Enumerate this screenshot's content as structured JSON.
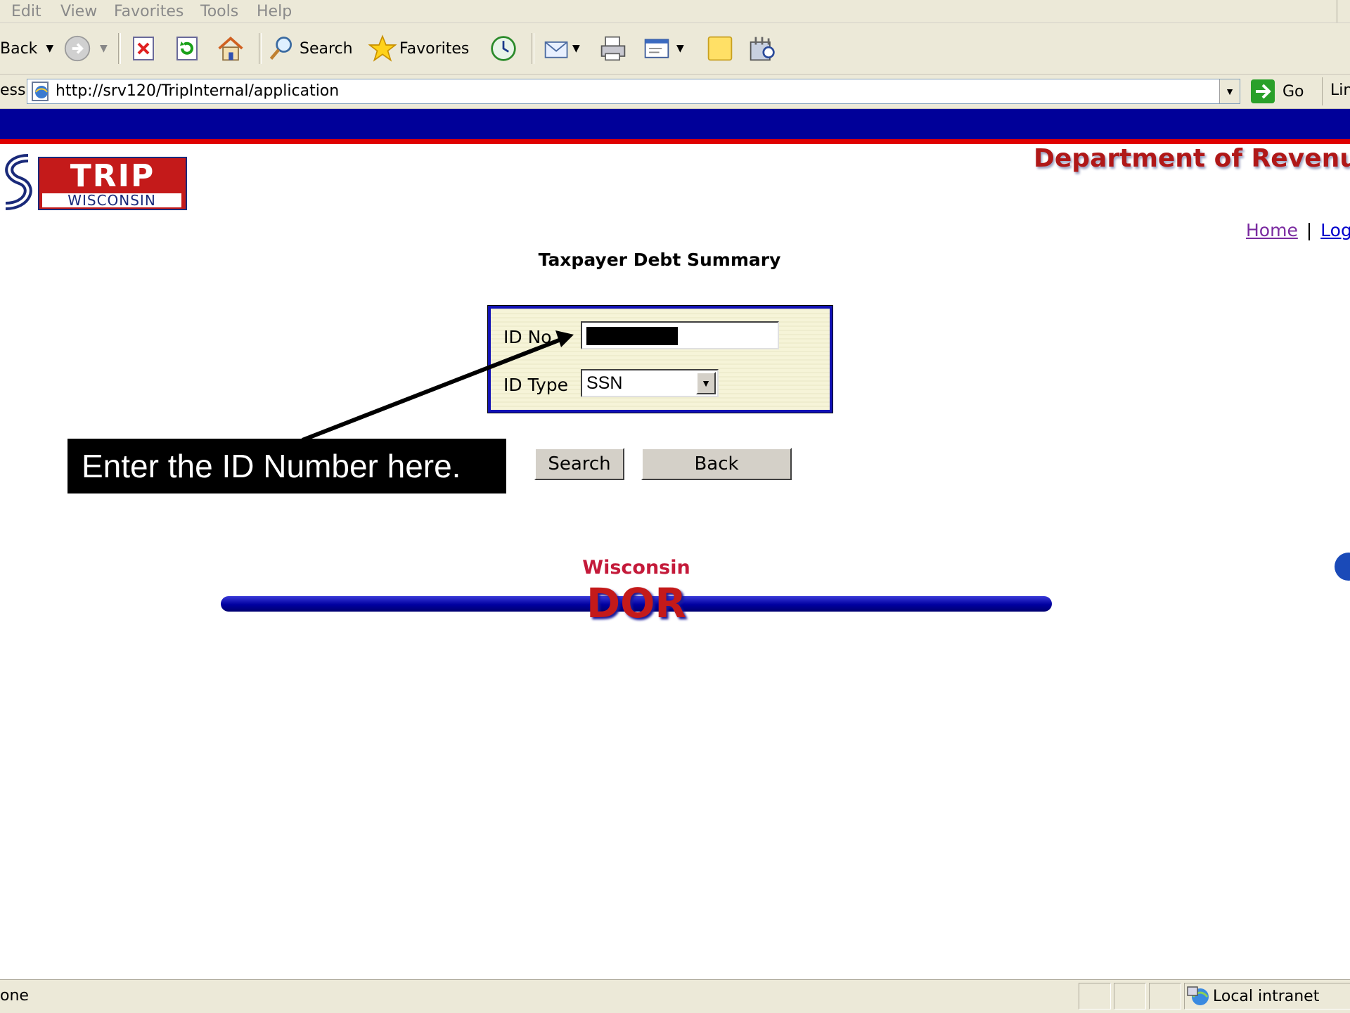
{
  "menu": [
    "Edit",
    "View",
    "Favorites",
    "Tools",
    "Help"
  ],
  "toolbar": {
    "back_label": "Back",
    "search_label": "Search",
    "favorites_label": "Favorites"
  },
  "address": {
    "label": "ess",
    "url": "http://srv120/TripInternal/application",
    "go_label": "Go",
    "links_label": "Lin"
  },
  "header": {
    "logo_trip": "TRIP",
    "logo_state": "WISCONSIN",
    "department": "Department of Revenu",
    "nav_home": "Home",
    "nav_sep": "|",
    "nav_logout": "Logo"
  },
  "form": {
    "title": "Taxpayer Debt Summary",
    "id_label": "ID No",
    "id_value": "",
    "type_label": "ID Type",
    "type_value": "SSN",
    "search_button": "Search",
    "back_button": "Back"
  },
  "callout": "Enter the ID Number here.",
  "footer_logo": {
    "top": "Wisconsin",
    "bottom": "DOR"
  },
  "status": {
    "left": "one",
    "zone": "Local intranet"
  },
  "colors": {
    "band_blue": "#000099",
    "band_red": "#e00000",
    "form_border": "#1212b5",
    "link": "#0000cc",
    "department": "#b01818"
  }
}
